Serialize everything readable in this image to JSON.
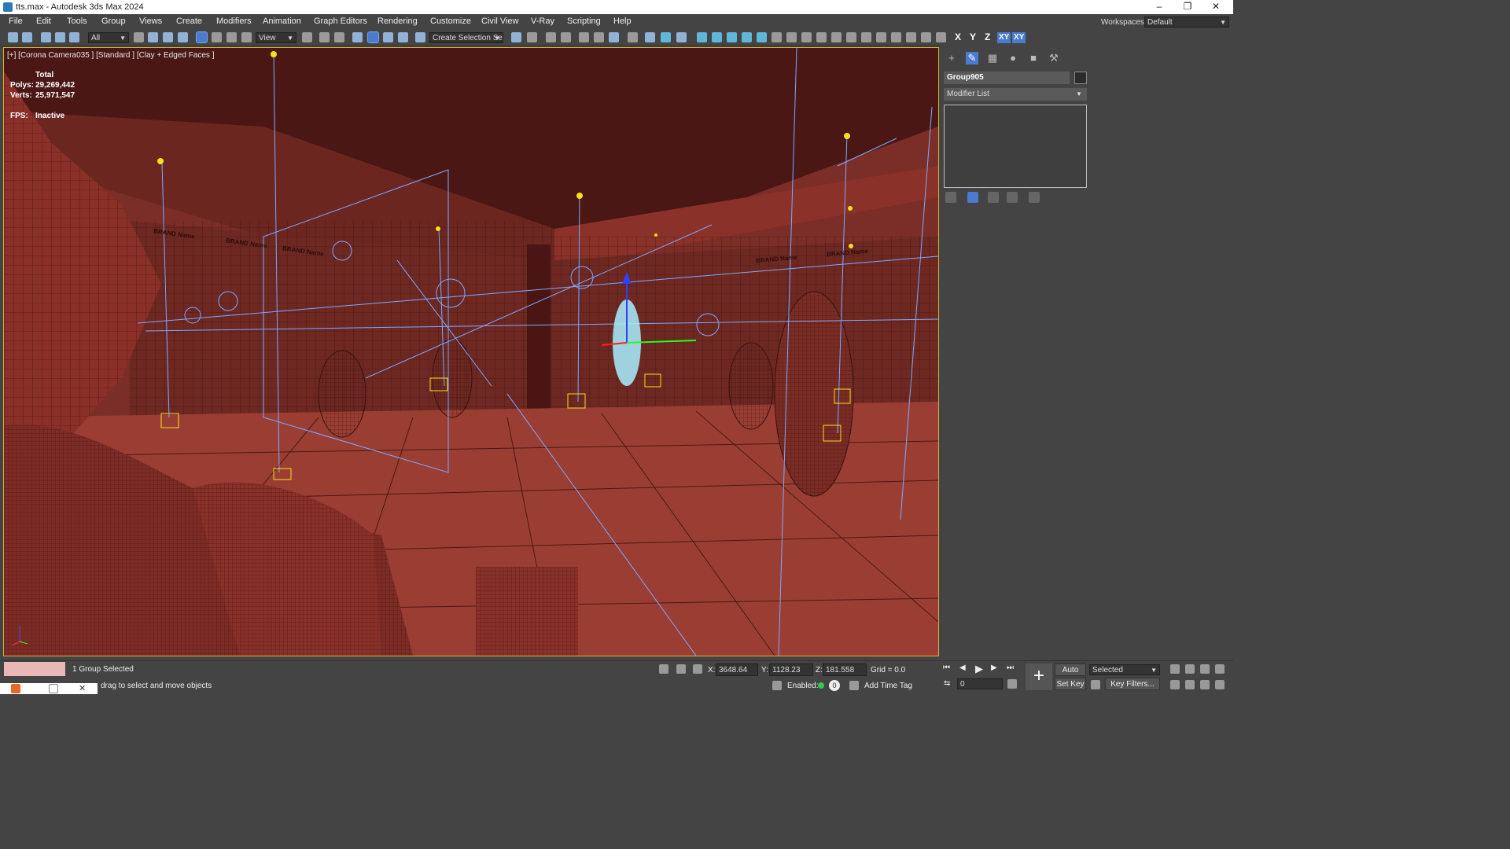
{
  "window": {
    "title": "tts.max - Autodesk 3ds Max 2024"
  },
  "menu": [
    "File",
    "Edit",
    "Tools",
    "Group",
    "Views",
    "Create",
    "Modifiers",
    "Animation",
    "Graph Editors",
    "Rendering",
    "Customize",
    "Civil View",
    "V-Ray",
    "Scripting",
    "Help"
  ],
  "workspace": {
    "label": "Workspaces:",
    "value": "Default"
  },
  "toolbar": {
    "selection_filter": "All",
    "ref_coord": "View",
    "selection_set": "Create Selection Se",
    "axis_x": "X",
    "axis_y": "Y",
    "axis_z": "Z",
    "axis_xy": "XY",
    "axis_xy2": "XY"
  },
  "viewport": {
    "label": "[+] [Corona Camera035 ] [Standard ] [Clay + Edged Faces ]",
    "stats_total": "Total",
    "polys_label": "Polys:",
    "polys_value": "29,269,442",
    "verts_label": "Verts:",
    "verts_value": "25,971,547",
    "fps_label": "FPS:",
    "fps_value": "Inactive",
    "brand_label": "BRAND Name"
  },
  "command_panel": {
    "object_name": "Group905",
    "modifier_list": "Modifier List"
  },
  "status": {
    "selection": "1 Group Selected",
    "prompt": "drag to select and move objects",
    "x_label": "X:",
    "x_value": "3648.64",
    "y_label": "Y:",
    "y_value": "1128.23",
    "z_label": "Z:",
    "z_value": "181.558",
    "grid": "Grid = 0.0",
    "enabled": "Enabled:",
    "add_time_tag": "Add Time Tag",
    "frame": "0",
    "auto_key": "Auto Key",
    "set_key": "Set Key",
    "key_mode": "Selected",
    "key_filters": "Key Filters..."
  },
  "colors": {
    "viewport_bg": "#7a2e27",
    "accent": "#4a7bd1",
    "selection_border": "#d6b23a"
  }
}
